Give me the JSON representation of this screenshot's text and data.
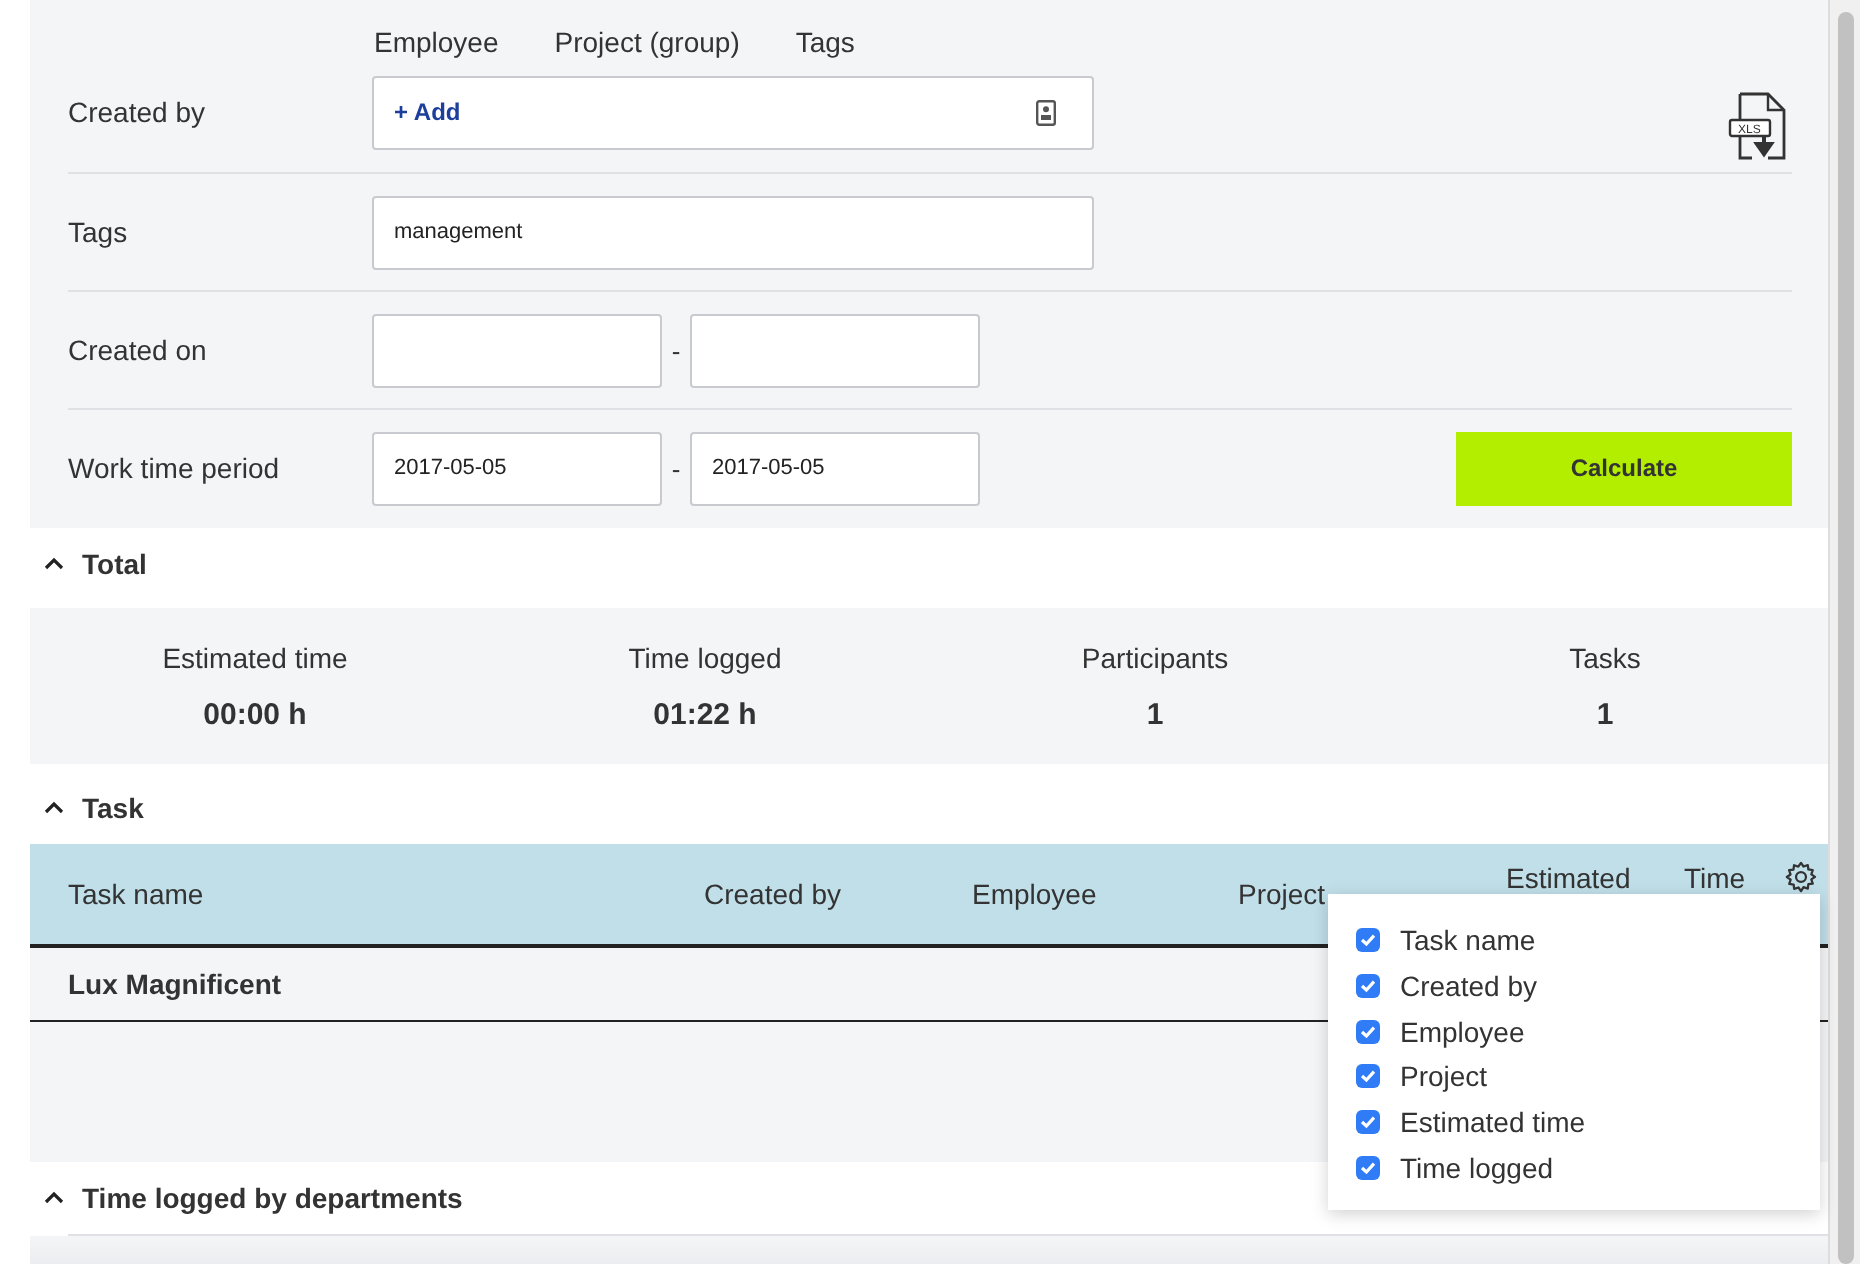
{
  "filter_tabs": [
    "Employee",
    "Project (group)",
    "Tags"
  ],
  "form": {
    "created_by": {
      "label": "Created by",
      "add": "+ Add"
    },
    "tags": {
      "label": "Tags",
      "value": "management"
    },
    "created_on": {
      "label": "Created on",
      "separator": "-"
    },
    "export_icon_text": "XLS",
    "work_time_period": {
      "label": "Work time period",
      "from": "2017-05-05",
      "to": "2017-05-05",
      "separator": "-"
    },
    "calculate_button": "Calculate"
  },
  "total": {
    "title": "Total",
    "expanded": true,
    "stats": [
      {
        "label": "Estimated time",
        "value": "00:00 h"
      },
      {
        "label": "Time logged",
        "value": "01:22 h"
      },
      {
        "label": "Participants",
        "value": "1"
      },
      {
        "label": "Tasks",
        "value": "1"
      }
    ]
  },
  "task": {
    "title": "Task",
    "expanded": true,
    "columns": [
      "Task name",
      "Created by",
      "Employee",
      "Project",
      "Estimated",
      "Time"
    ],
    "rows": [
      {
        "task_name": "Lux Magnificent"
      }
    ]
  },
  "column_menu": {
    "items": [
      {
        "label": "Task name",
        "checked": true
      },
      {
        "label": "Created by",
        "checked": true
      },
      {
        "label": "Employee",
        "checked": true
      },
      {
        "label": "Project",
        "checked": true
      },
      {
        "label": "Estimated time",
        "checked": true
      },
      {
        "label": "Time logged",
        "checked": true
      }
    ]
  },
  "departments": {
    "title": "Time logged by departments",
    "expanded": true
  }
}
